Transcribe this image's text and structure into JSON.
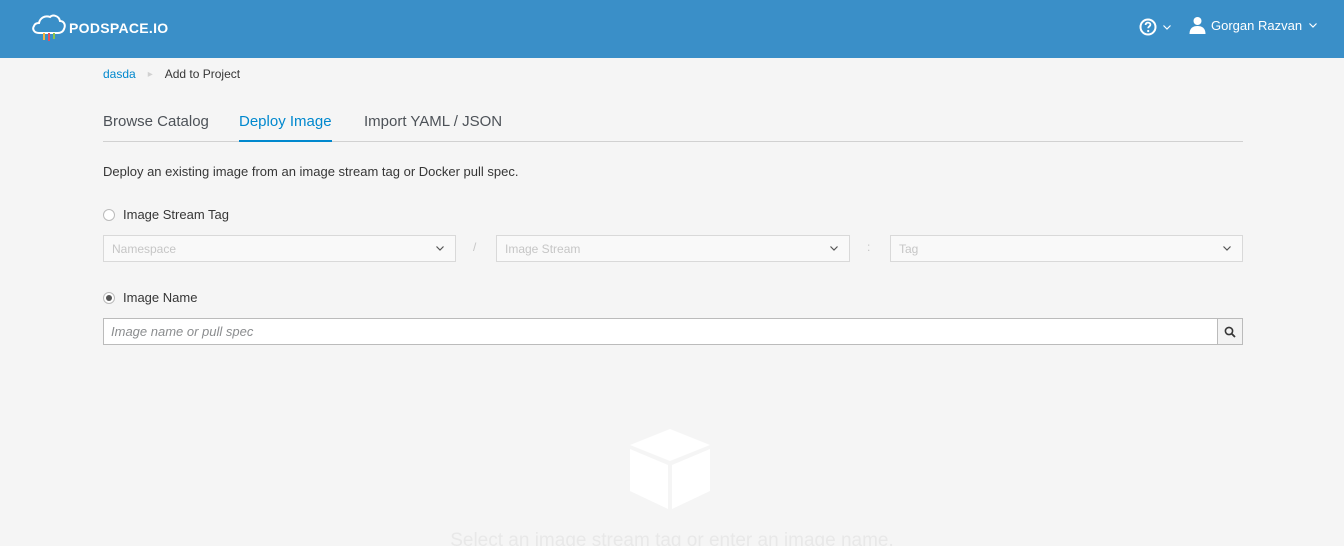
{
  "header": {
    "logo_text": "PODSPACE.IO",
    "user_name": "Gorgan Razvan",
    "brand_color": "#3a8fc8"
  },
  "breadcrumb": {
    "project": "dasda",
    "current": "Add to Project"
  },
  "tabs": [
    {
      "label": "Browse Catalog",
      "active": false
    },
    {
      "label": "Deploy Image",
      "active": true
    },
    {
      "label": "Import YAML / JSON",
      "active": false
    }
  ],
  "description": "Deploy an existing image from an image stream tag or Docker pull spec.",
  "image_stream_tag": {
    "label": "Image Stream Tag",
    "selected": false,
    "namespace_placeholder": "Namespace",
    "stream_placeholder": "Image Stream",
    "tag_placeholder": "Tag",
    "separator_slash": "/",
    "separator_colon": ":"
  },
  "image_name": {
    "label": "Image Name",
    "selected": true,
    "placeholder": "Image name or pull spec",
    "value": ""
  },
  "empty_state": {
    "icon": "cube-icon",
    "message": "Select an image stream tag or enter an image name."
  },
  "icons": {
    "help": "help-circle-icon",
    "user": "user-icon",
    "search": "search-icon",
    "caret": "chevron-down-icon"
  }
}
